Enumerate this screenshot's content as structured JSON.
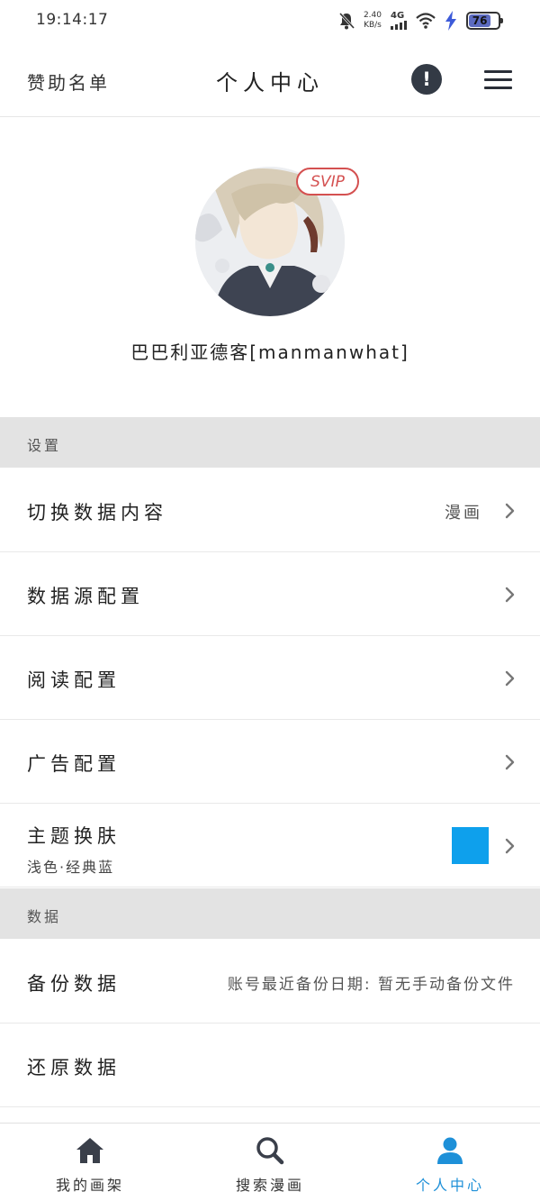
{
  "status_bar": {
    "time": "19:14:17",
    "net_speed_value": "2.40",
    "net_speed_unit": "KB/s",
    "signal_label": "4G",
    "battery_level": "76"
  },
  "header": {
    "left_label": "赞助名单",
    "title": "个人中心",
    "alert_icon": "!"
  },
  "profile": {
    "badge": "SVIP",
    "username": "巴巴利亚德客[manmanwhat]"
  },
  "sections": {
    "settings": {
      "title": "设置",
      "items": [
        {
          "label": "切换数据内容",
          "value": "漫画"
        },
        {
          "label": "数据源配置"
        },
        {
          "label": "阅读配置"
        },
        {
          "label": "广告配置"
        },
        {
          "label": "主题换肤",
          "subtitle": "浅色·经典蓝",
          "swatch_color": "#0ea0ec"
        }
      ]
    },
    "data": {
      "title": "数据",
      "items": [
        {
          "label": "备份数据",
          "value": "账号最近备份日期: 暂无手动备份文件"
        },
        {
          "label": "还原数据"
        }
      ]
    }
  },
  "tab_bar": {
    "tabs": [
      {
        "label": "我的画架",
        "icon": "home-icon"
      },
      {
        "label": "搜索漫画",
        "icon": "search-icon"
      },
      {
        "label": "个人中心",
        "icon": "user-icon",
        "active": true
      }
    ],
    "active_color": "#1e90d8"
  }
}
